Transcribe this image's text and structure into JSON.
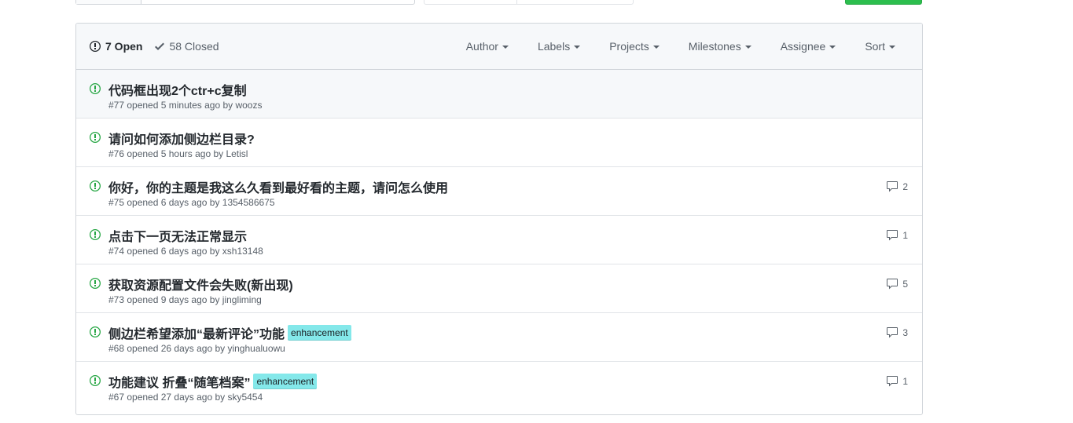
{
  "header": {
    "open_label": "7 Open",
    "closed_label": "58 Closed",
    "filters": [
      "Author",
      "Labels",
      "Projects",
      "Milestones",
      "Assignee",
      "Sort"
    ]
  },
  "issues": [
    {
      "title": "代码框出现2个ctr+c复制",
      "meta": "#77 opened 5 minutes ago by woozs",
      "label": "",
      "comments": ""
    },
    {
      "title": "请问如何添加侧边栏目录?",
      "meta": "#76 opened 5 hours ago by Letisl",
      "label": "",
      "comments": ""
    },
    {
      "title": "你好，你的主题是我这么久看到最好看的主题，请问怎么使用",
      "meta": "#75 opened 6 days ago by 1354586675",
      "label": "",
      "comments": "2"
    },
    {
      "title": "点击下一页无法正常显示",
      "meta": "#74 opened 6 days ago by xsh13148",
      "label": "",
      "comments": "1"
    },
    {
      "title": "获取资源配置文件会失败(新出现)",
      "meta": "#73 opened 9 days ago by jingliming",
      "label": "",
      "comments": "5"
    },
    {
      "title": "侧边栏希望添加“最新评论”功能",
      "meta": "#68 opened 26 days ago by yinghualuowu",
      "label": "enhancement",
      "comments": "3"
    },
    {
      "title": "功能建议 折叠“随笔档案”",
      "meta": "#67 opened 27 days ago by sky5454",
      "label": "enhancement",
      "comments": "1"
    }
  ],
  "colors": {
    "open_icon": "#28a745",
    "label_enhancement": "#84e8ea",
    "new_issue_button": "#2cbe4e"
  }
}
